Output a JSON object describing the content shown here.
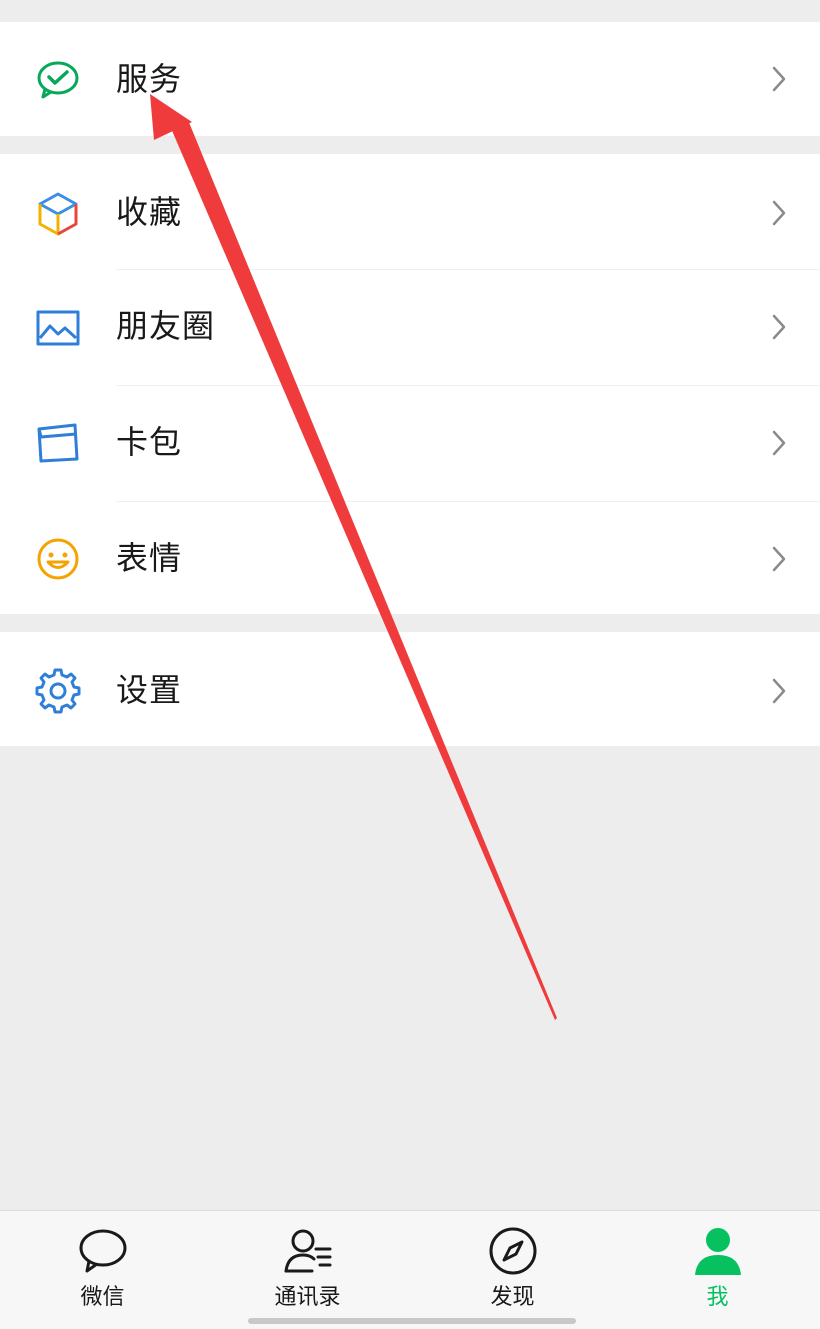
{
  "menu": {
    "service": "服务",
    "favorites": "收藏",
    "moments": "朋友圈",
    "cards": "卡包",
    "stickers": "表情",
    "settings": "设置"
  },
  "tabbar": {
    "chats": "微信",
    "contacts": "通讯录",
    "discover": "发现",
    "me": "我"
  },
  "colors": {
    "accent": "#07c160",
    "background": "#ededed",
    "annotation_arrow": "#ef3b3b"
  },
  "icons": {
    "service": "wechat-pay-icon",
    "favorites": "cube-icon",
    "moments": "image-icon",
    "cards": "card-wallet-icon",
    "stickers": "smiley-icon",
    "settings": "gear-icon",
    "chevron": "chevron-right-icon"
  }
}
